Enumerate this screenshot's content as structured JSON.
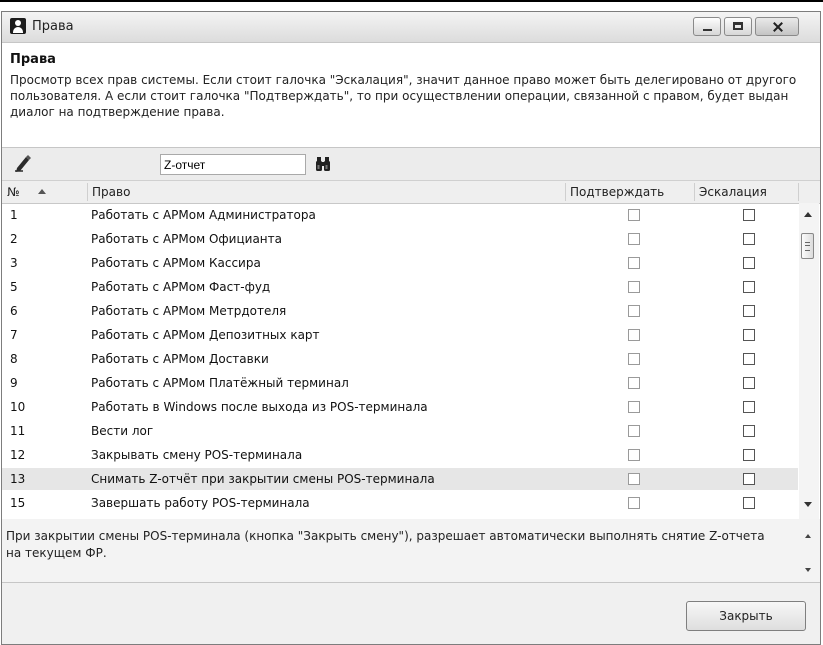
{
  "window": {
    "title": "Права"
  },
  "description": {
    "title": "Права",
    "text": "Просмотр всех прав системы.  Если стоит галочка \"Эскалация\", значит данное право может быть делегировано от другого пользователя. А если стоит галочка \"Подтверждать\", то при осуществлении операции, связанной с правом, будет выдан диалог на подтверждение права."
  },
  "toolbar": {
    "search_value": "Z-отчет",
    "edit_icon": "pencil-icon",
    "find_icon": "binoculars-icon"
  },
  "table": {
    "headers": {
      "num": "№",
      "name": "Право",
      "confirm": "Подтверждать",
      "escalation": "Эскалация"
    },
    "sort": "ascending",
    "selected_row_index": 11,
    "rows": [
      {
        "num": "1",
        "name": "Работать с АРМом Администратора",
        "confirm": false,
        "escalation": false
      },
      {
        "num": "2",
        "name": "Работать с АРМом Официанта",
        "confirm": false,
        "escalation": false
      },
      {
        "num": "3",
        "name": "Работать с АРМом Кассира",
        "confirm": false,
        "escalation": false
      },
      {
        "num": "5",
        "name": "Работать с АРМом Фаст-фуд",
        "confirm": false,
        "escalation": false
      },
      {
        "num": "6",
        "name": "Работать с АРМом Метрдотеля",
        "confirm": false,
        "escalation": false
      },
      {
        "num": "7",
        "name": "Работать с АРМом Депозитных карт",
        "confirm": false,
        "escalation": false
      },
      {
        "num": "8",
        "name": "Работать с АРМом Доставки",
        "confirm": false,
        "escalation": false
      },
      {
        "num": "9",
        "name": "Работать с АРМом Платёжный терминал",
        "confirm": false,
        "escalation": false
      },
      {
        "num": "10",
        "name": "Работать в Windows после выхода из POS-терминала",
        "confirm": false,
        "escalation": false
      },
      {
        "num": "11",
        "name": "Вести лог",
        "confirm": false,
        "escalation": false
      },
      {
        "num": "12",
        "name": "Закрывать смену POS-терминала",
        "confirm": false,
        "escalation": false
      },
      {
        "num": "13",
        "name": "Снимать Z-отчёт при закрытии смены POS-терминала",
        "confirm": false,
        "escalation": false
      },
      {
        "num": "15",
        "name": "Завершать работу POS-терминала",
        "confirm": false,
        "escalation": false
      }
    ]
  },
  "hint": {
    "text": "При закрытии смены POS-терминала (кнопка \"Закрыть смену\"), разрешает автоматически выполнять снятие Z-отчета на текущем ФР."
  },
  "footer": {
    "close_label": "Закрыть"
  }
}
